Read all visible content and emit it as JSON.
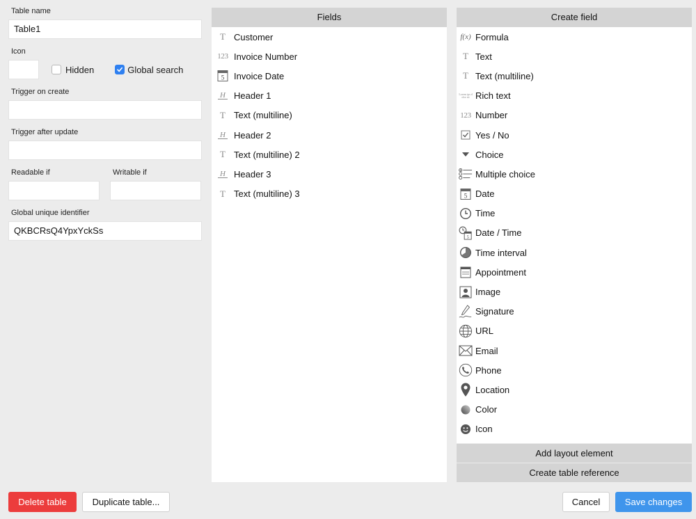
{
  "settings": {
    "table_name_label": "Table name",
    "table_name_value": "Table1",
    "icon_label": "Icon",
    "hidden_label": "Hidden",
    "hidden_checked": false,
    "global_search_label": "Global search",
    "global_search_checked": true,
    "trigger_create_label": "Trigger on create",
    "trigger_create_value": "",
    "trigger_update_label": "Trigger after update",
    "trigger_update_value": "",
    "readable_label": "Readable if",
    "readable_value": "",
    "writable_label": "Writable if",
    "writable_value": "",
    "guid_label": "Global unique identifier",
    "guid_value": "QKBCRsQ4YpxYckSs"
  },
  "fields": {
    "title": "Fields",
    "items": [
      {
        "label": "Customer",
        "icon": "text-icon"
      },
      {
        "label": "Invoice Number",
        "icon": "number-icon"
      },
      {
        "label": "Invoice Date",
        "icon": "date-icon"
      },
      {
        "label": "Header 1",
        "icon": "header-icon"
      },
      {
        "label": "Text (multiline)",
        "icon": "text-icon"
      },
      {
        "label": "Header 2",
        "icon": "header-icon"
      },
      {
        "label": "Text (multiline) 2",
        "icon": "text-icon"
      },
      {
        "label": "Header 3",
        "icon": "header-icon"
      },
      {
        "label": "Text (multiline) 3",
        "icon": "text-icon"
      }
    ]
  },
  "create": {
    "title": "Create field",
    "items": [
      {
        "label": "Formula",
        "icon": "formula-icon"
      },
      {
        "label": "Text",
        "icon": "text-icon"
      },
      {
        "label": "Text (multiline)",
        "icon": "text-icon"
      },
      {
        "label": "Rich text",
        "icon": "rich-text-icon"
      },
      {
        "label": "Number",
        "icon": "number-icon"
      },
      {
        "label": "Yes / No",
        "icon": "checkbox-icon"
      },
      {
        "label": "Choice",
        "icon": "choice-icon"
      },
      {
        "label": "Multiple choice",
        "icon": "multiple-choice-icon"
      },
      {
        "label": "Date",
        "icon": "date-icon"
      },
      {
        "label": "Time",
        "icon": "time-icon"
      },
      {
        "label": "Date / Time",
        "icon": "datetime-icon"
      },
      {
        "label": "Time interval",
        "icon": "time-interval-icon"
      },
      {
        "label": "Appointment",
        "icon": "appointment-icon"
      },
      {
        "label": "Image",
        "icon": "image-icon"
      },
      {
        "label": "Signature",
        "icon": "signature-icon"
      },
      {
        "label": "URL",
        "icon": "globe-icon"
      },
      {
        "label": "Email",
        "icon": "email-icon"
      },
      {
        "label": "Phone",
        "icon": "phone-icon"
      },
      {
        "label": "Location",
        "icon": "location-icon"
      },
      {
        "label": "Color",
        "icon": "color-icon"
      },
      {
        "label": "Icon",
        "icon": "smiley-icon"
      }
    ],
    "add_layout_label": "Add layout element",
    "create_reference_label": "Create table reference"
  },
  "icon_glyphs": {
    "text": "T",
    "number": "123",
    "header": "H",
    "formula": "f(x)",
    "date_day": "5",
    "rich_text": "Lorem ips dolor sit"
  },
  "buttons": {
    "delete": "Delete table",
    "duplicate": "Duplicate table...",
    "cancel": "Cancel",
    "save": "Save changes"
  },
  "colors": {
    "danger": "#ec3c3c",
    "primary": "#3f95ec",
    "checkbox": "#2f80f0"
  }
}
